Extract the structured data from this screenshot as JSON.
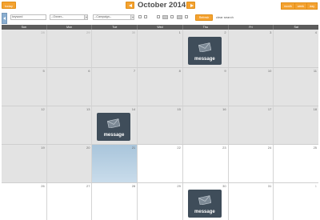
{
  "toolbar": {
    "today_label": "today",
    "month_title": "October 2014",
    "views": [
      "month",
      "week",
      "day"
    ]
  },
  "filters": {
    "keyword_value": "keyword",
    "owner_value": "--Owner--",
    "campaign_value": "--Campaign--",
    "refresh_label": "Refresh",
    "clear_label": "clear search"
  },
  "calendar": {
    "day_headers": [
      "Sun",
      "Mon",
      "Tue",
      "Wed",
      "Thu",
      "Fri",
      "Sat"
    ],
    "weeks": [
      [
        "28",
        "29",
        "30",
        "1",
        "2",
        "3",
        "4"
      ],
      [
        "5",
        "6",
        "7",
        "8",
        "9",
        "10",
        "11"
      ],
      [
        "12",
        "13",
        "14",
        "15",
        "16",
        "17",
        "18"
      ],
      [
        "19",
        "20",
        "21",
        "22",
        "23",
        "24",
        "25"
      ],
      [
        "26",
        "27",
        "28",
        "29",
        "30",
        "31",
        "1"
      ]
    ],
    "event_label": "message"
  },
  "colors": {
    "accent": "#f4a230",
    "event_bg": "#3f4d5a",
    "header_bg": "#5c5c5c",
    "today_bg": "#b7d0e3"
  },
  "icons": {
    "prev": "chevron-left-icon",
    "next": "chevron-right-icon",
    "event": "envelope-icon"
  }
}
